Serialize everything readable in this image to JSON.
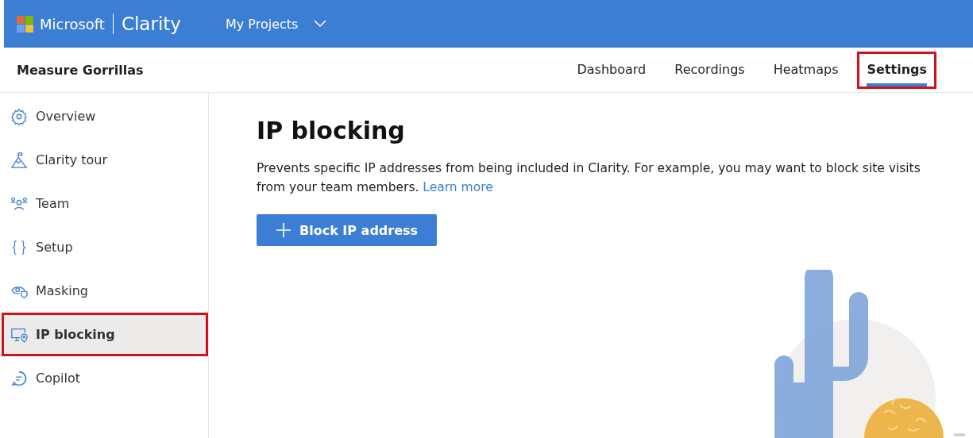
{
  "topbar": {
    "brand": "Microsoft",
    "product": "Clarity",
    "projects_menu": "My Projects"
  },
  "project": {
    "name": "Measure Gorrillas"
  },
  "tabs": [
    {
      "label": "Dashboard",
      "selected": false,
      "highlighted": false
    },
    {
      "label": "Recordings",
      "selected": false,
      "highlighted": false
    },
    {
      "label": "Heatmaps",
      "selected": false,
      "highlighted": false
    },
    {
      "label": "Settings",
      "selected": true,
      "highlighted": true
    }
  ],
  "sidebar": {
    "items": [
      {
        "kind": "gear",
        "label": "Overview",
        "selected": false,
        "highlighted": false
      },
      {
        "kind": "mountain",
        "label": "Clarity tour",
        "selected": false,
        "highlighted": false
      },
      {
        "kind": "people",
        "label": "Team",
        "selected": false,
        "highlighted": false
      },
      {
        "kind": "braces",
        "label": "Setup",
        "selected": false,
        "highlighted": false
      },
      {
        "kind": "eye",
        "label": "Masking",
        "selected": false,
        "highlighted": false
      },
      {
        "kind": "monitor",
        "label": "IP blocking",
        "selected": true,
        "highlighted": true
      },
      {
        "kind": "chat",
        "label": "Copilot",
        "selected": false,
        "highlighted": false
      }
    ]
  },
  "content": {
    "title": "IP blocking",
    "description": "Prevents specific IP addresses from being included in Clarity. For example, you may want to block site visits from your team members.",
    "learn_more": "Learn more",
    "button": "Block IP address"
  }
}
